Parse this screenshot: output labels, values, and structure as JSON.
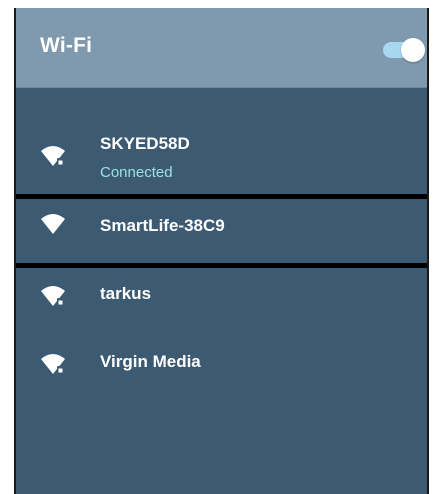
{
  "header": {
    "title": "Wi-Fi",
    "toggle_on": true
  },
  "networks": [
    {
      "ssid": "SKYED58D",
      "status": "Connected",
      "locked": true,
      "icon": "wifi-locked-icon"
    },
    {
      "ssid": "SmartLife-38C9",
      "status": "",
      "locked": false,
      "icon": "wifi-icon"
    },
    {
      "ssid": "tarkus",
      "status": "",
      "locked": true,
      "icon": "wifi-locked-icon"
    },
    {
      "ssid": "Virgin Media",
      "status": "",
      "locked": true,
      "icon": "wifi-locked-icon"
    }
  ],
  "colors": {
    "header_bg": "#7f9aaf",
    "panel_bg": "#3d5a73",
    "connected_text": "#9fe1e0",
    "toggle_track": "#a8d8ef",
    "highlight_border": "#000000"
  }
}
